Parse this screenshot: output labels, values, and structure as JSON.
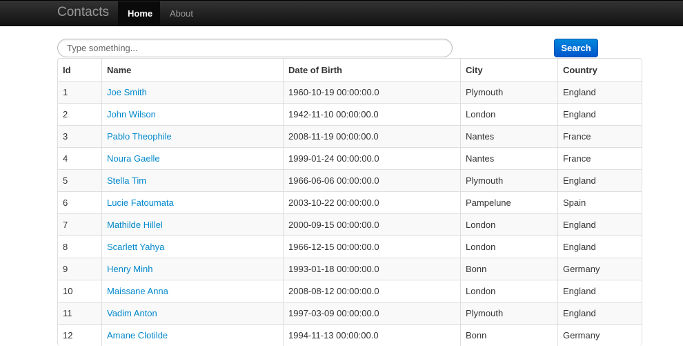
{
  "navbar": {
    "brand": "Contacts",
    "items": [
      {
        "label": "Home",
        "active": true
      },
      {
        "label": "About",
        "active": false
      }
    ]
  },
  "search": {
    "placeholder": "Type something...",
    "value": "",
    "button_label": "Search"
  },
  "table": {
    "headers": [
      "Id",
      "Name",
      "Date of Birth",
      "City",
      "Country"
    ],
    "rows": [
      {
        "id": "1",
        "name": "Joe Smith",
        "dob": "1960-10-19 00:00:00.0",
        "city": "Plymouth",
        "country": "England"
      },
      {
        "id": "2",
        "name": "John Wilson",
        "dob": "1942-11-10 00:00:00.0",
        "city": "London",
        "country": "England"
      },
      {
        "id": "3",
        "name": "Pablo Theophile",
        "dob": "2008-11-19 00:00:00.0",
        "city": "Nantes",
        "country": "France"
      },
      {
        "id": "4",
        "name": "Noura Gaelle",
        "dob": "1999-01-24 00:00:00.0",
        "city": "Nantes",
        "country": "France"
      },
      {
        "id": "5",
        "name": "Stella Tim",
        "dob": "1966-06-06 00:00:00.0",
        "city": "Plymouth",
        "country": "England"
      },
      {
        "id": "6",
        "name": "Lucie Fatoumata",
        "dob": "2003-10-22 00:00:00.0",
        "city": "Pampelune",
        "country": "Spain"
      },
      {
        "id": "7",
        "name": "Mathilde Hillel",
        "dob": "2000-09-15 00:00:00.0",
        "city": "London",
        "country": "England"
      },
      {
        "id": "8",
        "name": "Scarlett Yahya",
        "dob": "1966-12-15 00:00:00.0",
        "city": "London",
        "country": "England"
      },
      {
        "id": "9",
        "name": "Henry Minh",
        "dob": "1993-01-18 00:00:00.0",
        "city": "Bonn",
        "country": "Germany"
      },
      {
        "id": "10",
        "name": "Maissane Anna",
        "dob": "2008-08-12 00:00:00.0",
        "city": "London",
        "country": "England"
      },
      {
        "id": "11",
        "name": "Vadim Anton",
        "dob": "1997-03-09 00:00:00.0",
        "city": "Plymouth",
        "country": "England"
      },
      {
        "id": "12",
        "name": "Amane Clotilde",
        "dob": "1994-11-13 00:00:00.0",
        "city": "Bonn",
        "country": "Germany"
      }
    ]
  },
  "colors": {
    "navbar": "#1b1b1b",
    "link": "#0088cc",
    "button": "#0070d8"
  }
}
